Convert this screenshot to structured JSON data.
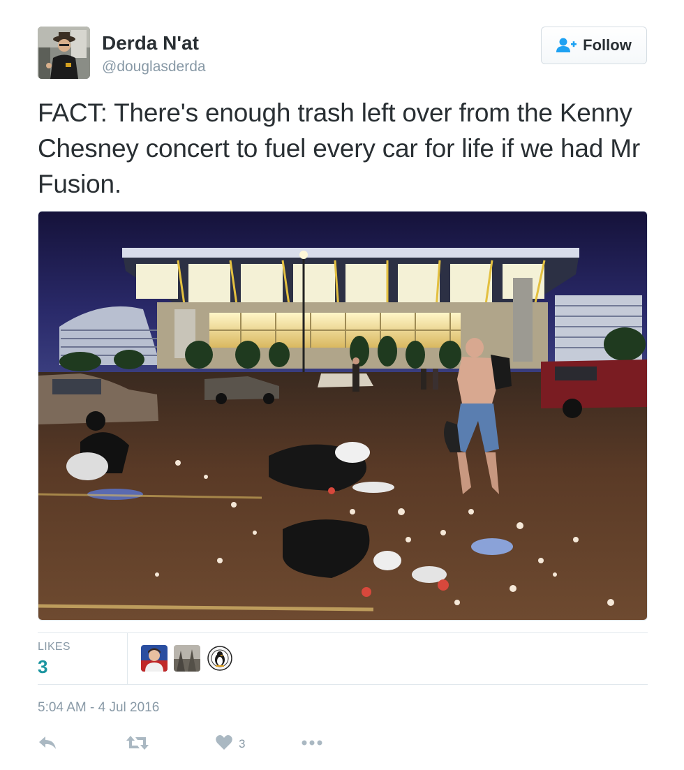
{
  "user": {
    "display_name": "Derda N'at",
    "handle": "@douglasderda"
  },
  "follow_button": {
    "label": "Follow",
    "icon": "follow-user-icon"
  },
  "tweet": {
    "text": "FACT: There's enough trash left over from the Kenny Chesney concert to fuel every car for life if we had Mr Fusion."
  },
  "stats": {
    "likes_label": "LIKES",
    "likes_count": "3"
  },
  "timestamp": "5:04 AM - 4 Jul 2016",
  "actions": {
    "reply_icon": "reply-icon",
    "retweet_icon": "retweet-icon",
    "like_icon": "heart-icon",
    "like_count": "3",
    "more_icon": "more-icon"
  },
  "colors": {
    "text": "#292f33",
    "muted": "#8899a6",
    "likes_accent": "#1b95a0",
    "follow_icon": "#1da1f2",
    "border": "#e1e8ed"
  }
}
